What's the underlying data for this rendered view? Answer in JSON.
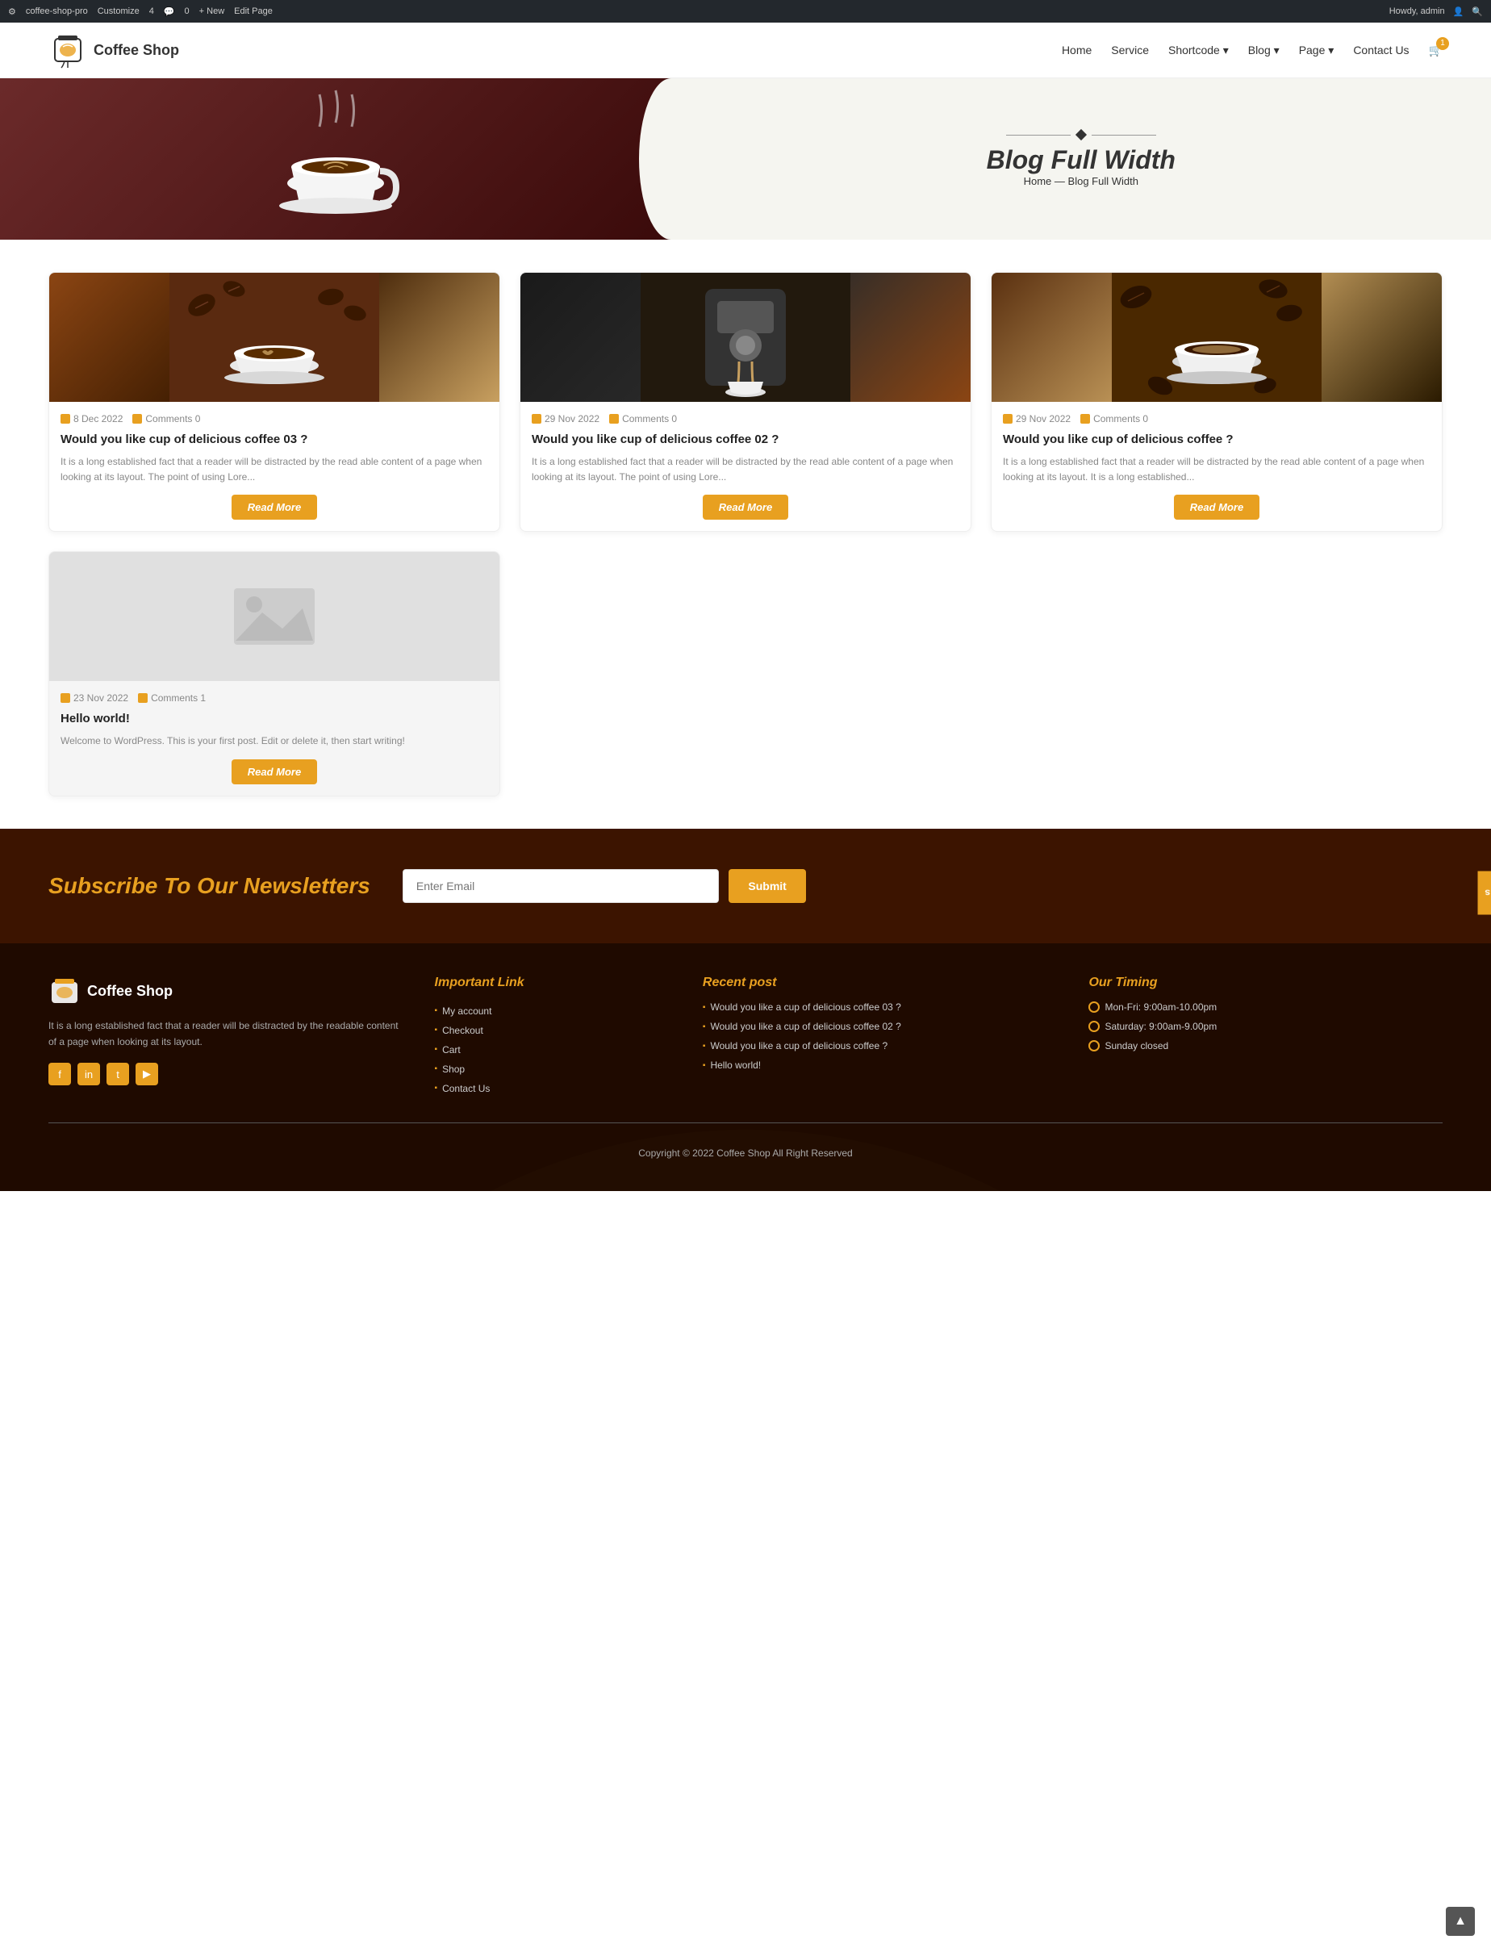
{
  "adminBar": {
    "siteName": "coffee-shop-pro",
    "customize": "Customize",
    "commentsCount": "4",
    "comments": "0",
    "new": "+ New",
    "editPage": "Edit Page",
    "howdy": "Howdy, admin"
  },
  "header": {
    "logoText": "Coffee Shop",
    "nav": {
      "home": "Home",
      "service": "Service",
      "shortcode": "Shortcode",
      "blog": "Blog",
      "page": "Page",
      "contactUs": "Contact Us"
    },
    "cartCount": "1"
  },
  "hero": {
    "title": "Blog Full Width",
    "breadcrumb1": "Home",
    "separator": "—",
    "breadcrumb2": "Blog Full Width"
  },
  "sideTab": {
    "label": "Contact Us"
  },
  "blog": {
    "cards": [
      {
        "date": "8 Dec 2022",
        "comments": "Comments 0",
        "title": "Would you like cup of delicious coffee 03 ?",
        "excerpt": "It is a long established fact that a reader will be distracted by the read able content of a page when looking at its layout. The point of using Lore...",
        "btnLabel": "Read More",
        "imgType": "img1"
      },
      {
        "date": "29 Nov 2022",
        "comments": "Comments 0",
        "title": "Would you like cup of delicious coffee 02 ?",
        "excerpt": "It is a long established fact that a reader will be distracted by the read able content of a page when looking at its layout. The point of using Lore...",
        "btnLabel": "Read More",
        "imgType": "img2"
      },
      {
        "date": "29 Nov 2022",
        "comments": "Comments 0",
        "title": "Would you like cup of delicious coffee ?",
        "excerpt": "It is a long established fact that a reader will be distracted by the read able content of a page when looking at its layout. It is a long established...",
        "btnLabel": "Read More",
        "imgType": "img3"
      }
    ],
    "singleCard": {
      "date": "23 Nov 2022",
      "comments": "Comments 1",
      "title": "Hello world!",
      "excerpt": "Welcome to WordPress. This is your first post. Edit or delete it, then start writing!",
      "btnLabel": "Read More",
      "imgType": "placeholder"
    }
  },
  "newsletter": {
    "title": "Subscribe To Our Newsletters",
    "inputPlaceholder": "Enter Email",
    "submitLabel": "Submit"
  },
  "footer": {
    "logoText": "Coffee Shop",
    "desc": "It is a long established fact that a reader will be distracted by the readable content of a page when looking at its layout.",
    "socials": [
      "f",
      "in",
      "t",
      "yt"
    ],
    "importantLink": {
      "title": "Important Link",
      "links": [
        "My account",
        "Checkout",
        "Cart",
        "Shop",
        "Contact Us"
      ]
    },
    "recentPost": {
      "title": "Recent post",
      "posts": [
        "Would you like a cup of delicious coffee 03 ?",
        "Would you like a cup of delicious coffee 02 ?",
        "Would you like a cup of delicious coffee ?",
        "Hello world!"
      ]
    },
    "timing": {
      "title": "Our Timing",
      "hours": [
        "Mon-Fri: 9:00am-10.00pm",
        "Saturday: 9:00am-9.00pm",
        "Sunday closed"
      ]
    },
    "copyright": "Copyright © 2022 Coffee Shop All Right Reserved"
  }
}
